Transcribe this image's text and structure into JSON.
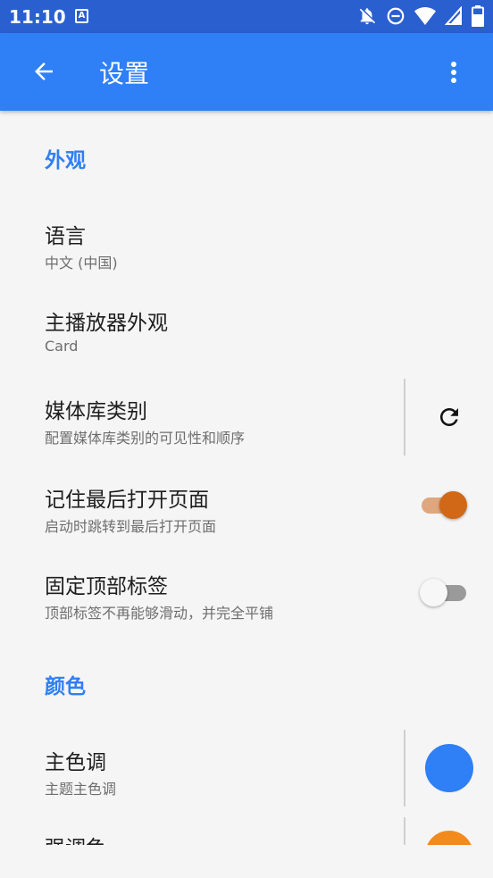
{
  "status_bar": {
    "time": "11:10",
    "notification_glyph": "A",
    "icons": [
      "notifications-off-icon",
      "do-not-disturb-icon",
      "wifi-icon",
      "cell-signal-icon",
      "battery-icon"
    ]
  },
  "app_bar": {
    "title": "设置",
    "back_icon": "arrow-back-icon",
    "menu_icon": "more-vert-icon"
  },
  "sections": {
    "appearance": {
      "label": "外观"
    },
    "color": {
      "label": "颜色"
    }
  },
  "settings": {
    "language": {
      "title": "语言",
      "subtitle": "中文 (中国)"
    },
    "player_appearance": {
      "title": "主播放器外观",
      "subtitle": "Card"
    },
    "library_categories": {
      "title": "媒体库类别",
      "subtitle": "配置媒体库类别的可见性和顺序",
      "action_icon": "refresh-icon"
    },
    "remember_last_page": {
      "title": "记住最后打开页面",
      "subtitle": "启动时跳转到最后打开页面",
      "enabled": true
    },
    "fixed_tabs": {
      "title": "固定顶部标签",
      "subtitle": "顶部标签不再能够滑动，并完全平铺",
      "enabled": false
    },
    "primary_color": {
      "title": "主色调",
      "subtitle": "主题主色调",
      "color": "#2f7ff6"
    },
    "accent_color": {
      "title": "强调色",
      "color": "#f28a1c"
    }
  },
  "colors": {
    "status_bar": "#2a5fd0",
    "app_bar": "#2f7ff6",
    "accent": "#d06818",
    "background": "#f5f5f5"
  }
}
